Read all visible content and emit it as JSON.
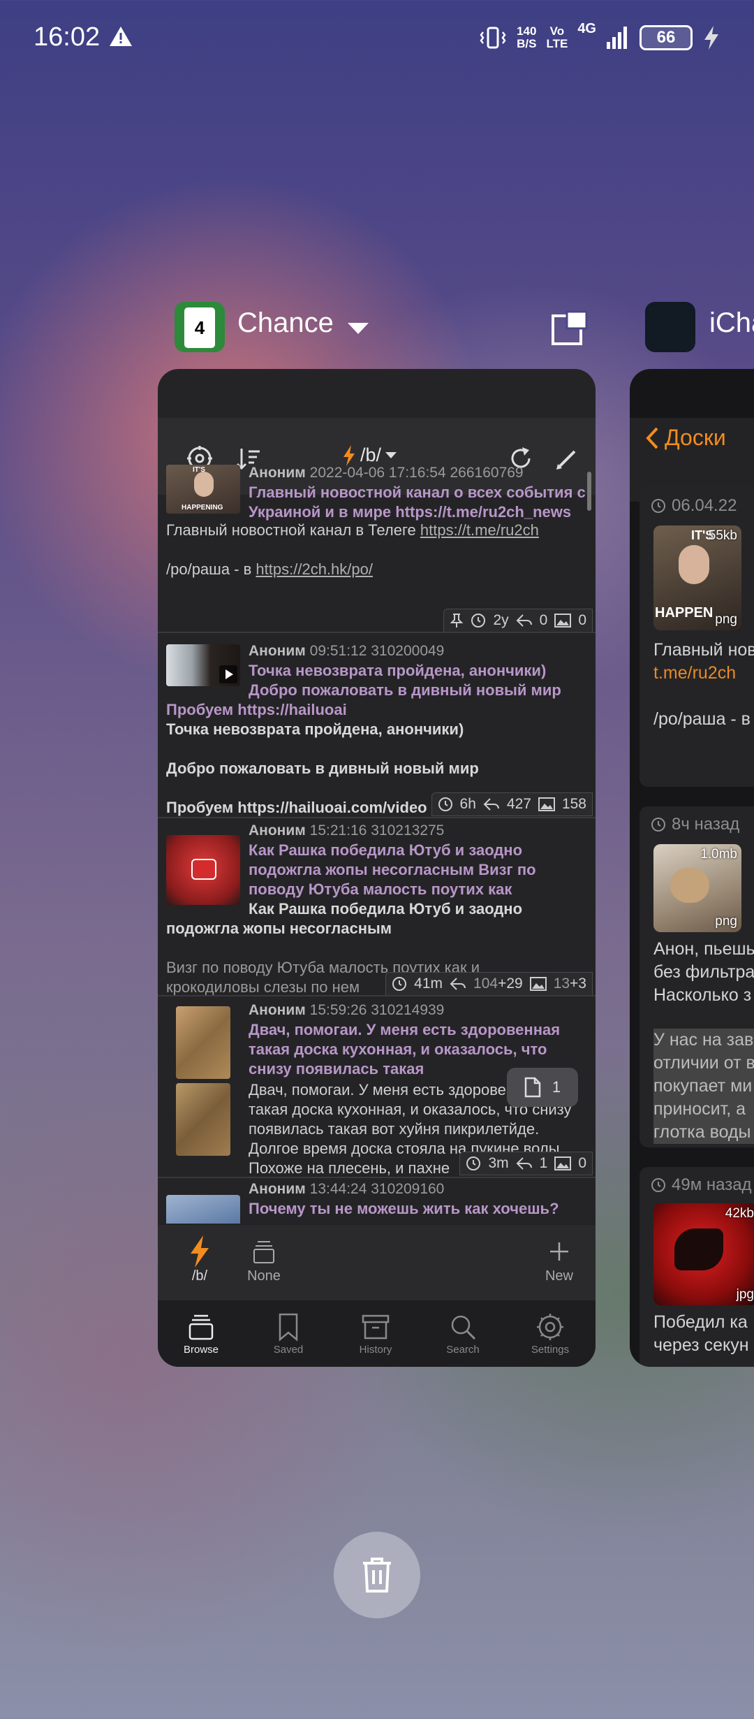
{
  "status_bar": {
    "time": "16:02",
    "warning_icon": "warning-icon",
    "net_speed_value": "140",
    "net_speed_unit": "B/S",
    "volte_top": "Vo",
    "volte_bottom": "LTE",
    "network": "4G",
    "battery": "66",
    "colors": {
      "text": "#ffffff"
    }
  },
  "recents": {
    "app1": {
      "name": "Chance",
      "icon": "chance-app-icon",
      "card_digit": "4"
    },
    "app2": {
      "name": "iChan"
    },
    "split_screen_icon": "split-screen-icon",
    "clear_all_icon": "trash-icon"
  },
  "chance": {
    "toolbar": {
      "board": "/b/",
      "icons": [
        "settings-icon",
        "sort-icon",
        "refresh-icon",
        "edit-icon"
      ]
    },
    "threads": [
      {
        "author": "Аноним",
        "date": "2022-04-06 17:16:54",
        "num": "266160769",
        "subject": [
          "Главный новостной канал о всех события с",
          "Украиной и в мире https://t.me/ru2ch_news"
        ],
        "body": [
          "Главный новостной канал в Телеге",
          "https://t.me/ru2ch",
          "/ро/раша - в",
          "https://2ch.hk/po/"
        ],
        "thumb_text": [
          "IT'S",
          "HAPPENING"
        ],
        "stats": {
          "age": "2y",
          "replies": "0",
          "images": "0"
        }
      },
      {
        "author": "Аноним",
        "date": "09:51:12",
        "num": "310200049",
        "subject": [
          "Точка невозврата пройдена, анончики)",
          "Добро пожаловать в дивный новый мир",
          "Пробуем https://hailuoai"
        ],
        "body": [
          "Точка невозврата пройдена, анончики)",
          "Добро пожаловать в дивный новый мир",
          "Пробуем https://hailuoai.com/video"
        ],
        "stats": {
          "age": "6h",
          "replies": "427",
          "images": "158"
        }
      },
      {
        "author": "Аноним",
        "date": "15:21:16",
        "num": "310213275",
        "subject": [
          "Как Рашка победила Ютуб и заодно",
          "подожгла жопы несогласным  Визг по",
          "поводу Ютуба малость поутих как"
        ],
        "body_bold": [
          "Как Рашка победила Ютуб и заодно",
          "подожгла жопы несогласным"
        ],
        "body": [
          "Визг по поводу Ютуба малость поутих как и",
          "крокодиловы слезы по нем"
        ],
        "stats": {
          "age": "41m",
          "replies": "104",
          "replies_new": "+29",
          "images": "13",
          "images_new": "+3"
        }
      },
      {
        "author": "Аноним",
        "date": "15:59:26",
        "num": "310214939",
        "subject": [
          "Двач, помогаи. У меня есть здоровенная",
          "такая доска кухонная, и оказалось, что",
          "снизу появилась такая"
        ],
        "body": [
          "Двач, помогаи. У меня есть здоровенная",
          "такая доска кухонная, и оказалось, что снизу",
          "появилась такая вот хуйня пикрилетйде.",
          "Долгое время доска стояла на пукине волы",
          "Похоже на плесень, и пахне"
        ],
        "stats": {
          "age": "3m",
          "replies": "1",
          "images": "0"
        }
      },
      {
        "author": "Аноним",
        "date": "13:44:24",
        "num": "310209160",
        "subject": [
          "Почему ты не можешь жить как хочешь?"
        ]
      }
    ],
    "page_chip": "1",
    "tabs": [
      {
        "label": "/b/",
        "icon": "lightning-icon"
      },
      {
        "label": "None",
        "icon": "stack-icon"
      },
      {
        "label": "New",
        "icon": "plus-icon"
      }
    ],
    "bottom_nav": [
      {
        "label": "Browse",
        "icon": "browse-icon",
        "active": true
      },
      {
        "label": "Saved",
        "icon": "bookmark-icon"
      },
      {
        "label": "History",
        "icon": "history-icon"
      },
      {
        "label": "Search",
        "icon": "search-icon"
      },
      {
        "label": "Settings",
        "icon": "gear-icon"
      }
    ],
    "colors": {
      "accent": "#f28c1e",
      "subject": "#b896c8",
      "card_bg": "#242426"
    }
  },
  "ichan": {
    "back_label": "Доски",
    "posts": [
      {
        "time": "06.04.22",
        "img_size": "55kb",
        "img_type": "png",
        "img_text": [
          "IT'S",
          "HAPPEN"
        ],
        "lines": [
          "Главный нов"
        ],
        "link": "t.me/ru2ch",
        "extra": "/ро/раша - в"
      },
      {
        "time": "8ч назад",
        "img_size": "1.0mb",
        "img_type": "png",
        "lines": [
          "Анон, пьешь",
          "без фильтра",
          "Насколько з"
        ],
        "quote": [
          "У нас на зав",
          "отличии от в",
          "покупает ми",
          "приносит, а",
          "глотка воды"
        ]
      },
      {
        "time": "49м назад",
        "img_size": "42kb",
        "img_type": "jpg",
        "lines": [
          "Победил ка",
          "через секун"
        ]
      }
    ],
    "colors": {
      "accent": "#e98a22"
    }
  }
}
